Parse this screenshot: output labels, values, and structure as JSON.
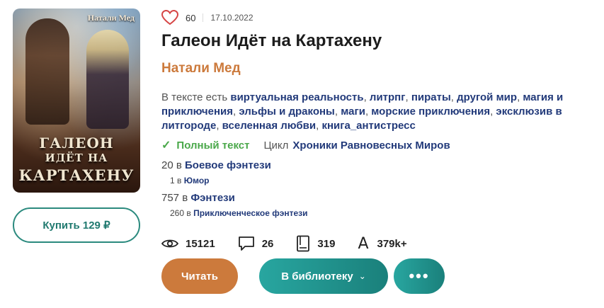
{
  "cover": {
    "author_text": "Натали Мед",
    "title_line1": "ГАЛЕОН",
    "title_line2": "ИДЁТ НА",
    "title_line3": "КАРТАХЕНУ"
  },
  "buy_label": "Купить 129 ₽",
  "likes": "60",
  "date": "17.10.2022",
  "title": "Галеон Идёт на Картахену",
  "author": "Натали Мед",
  "tags_prefix": "В тексте есть",
  "tags": [
    "виртуальная реальность",
    "литрпг",
    "пираты",
    "другой мир",
    "магия и приключения",
    "эльфы и драконы",
    "маги",
    "морские приключения",
    "эксклюзив в литгороде",
    "вселенная любви",
    "книга_антистресс"
  ],
  "status": "Полный текст",
  "cycle_label": "Цикл",
  "cycle_name": "Хроники Равновесных Миров",
  "rankings": [
    {
      "position": "20 в",
      "genre": "Боевое фэнтези"
    },
    {
      "position": "1 в",
      "genre": "Юмор"
    },
    {
      "position": "757 в",
      "genre": "Фэнтези"
    },
    {
      "position": "260 в",
      "genre": "Приключенческое фэнтези"
    }
  ],
  "stats": {
    "views": "15121",
    "comments": "26",
    "pages": "319",
    "font_letter": "A",
    "characters": "379k+"
  },
  "actions": {
    "read": "Читать",
    "library": "В библиотеку",
    "chevron": "⌄",
    "more": "•••"
  },
  "colors": {
    "accent_orange": "#cc7a3c",
    "accent_teal": "#1f9690",
    "link_blue": "#223a7a",
    "status_green": "#4aa84a",
    "heart_red": "#d64545"
  }
}
